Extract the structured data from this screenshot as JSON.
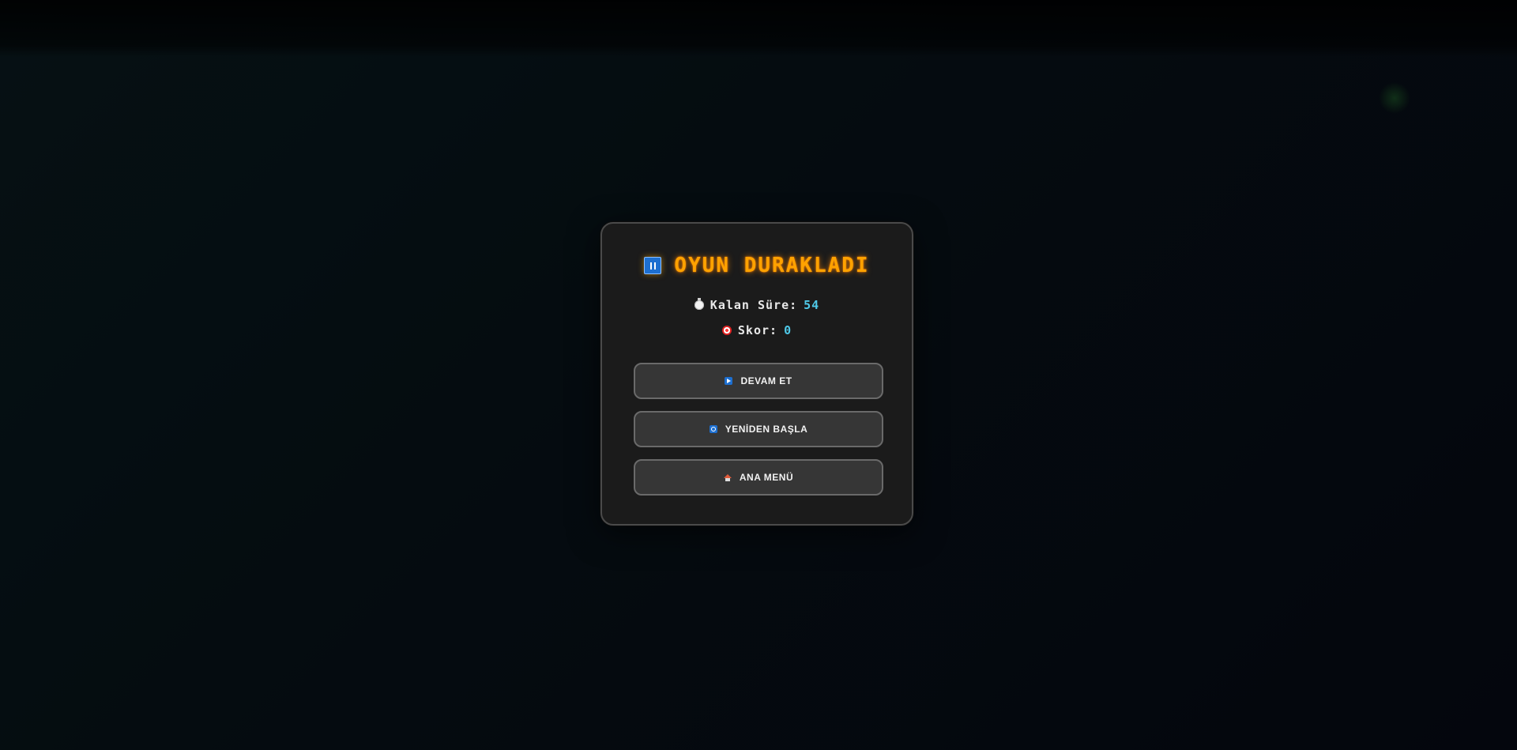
{
  "pause_menu": {
    "title": "OYUN DURAKLADI",
    "title_icon": "pause-icon",
    "time_label": "Kalan Süre:",
    "time_value": "54",
    "time_icon": "stopwatch-icon",
    "score_label": "Skor:",
    "score_value": "0",
    "score_icon": "target-icon",
    "buttons": [
      {
        "label": "DEVAM ET",
        "icon": "play-icon"
      },
      {
        "label": "YENİDEN BAŞLA",
        "icon": "restart-icon"
      },
      {
        "label": "ANA MENÜ",
        "icon": "home-icon"
      }
    ]
  },
  "colors": {
    "title": "#ffa200",
    "value": "#4fc9e8",
    "panel": "#1b1b1b",
    "button": "#363636"
  }
}
